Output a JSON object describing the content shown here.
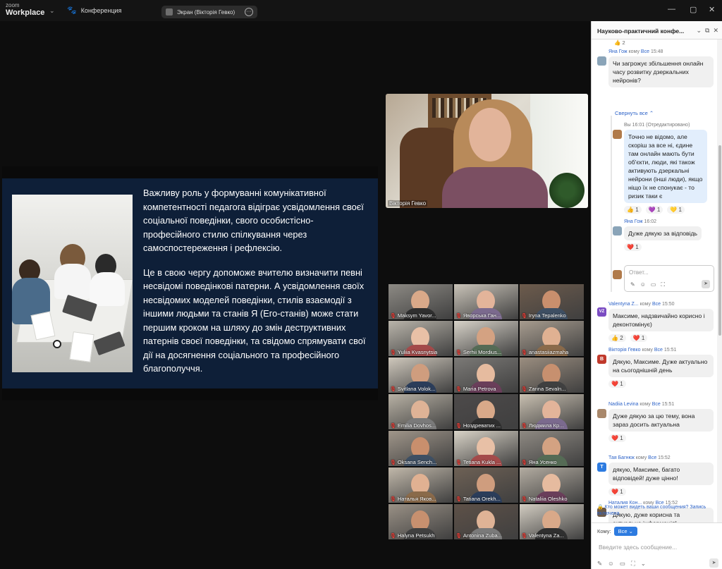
{
  "titlebar": {
    "logo_small": "zoom",
    "logo_big": "Workplace",
    "conference_label": "Конференция",
    "share_label": "Экран (Вікторія Гевко)",
    "min_icon": "minimize-icon",
    "max_icon": "maximize-icon",
    "close_icon": "close-icon"
  },
  "slide": {
    "paragraph1": "Важливу роль у формуванні комунікативної компетентності педагога відіграє усвідомлення своєї соціальної поведінки, свого особистісно-професійного стилю спілкування через самоспостереження і рефлексію.",
    "paragraph2": "Це в свою чергу допоможе вчителю визначити певні несвідомі поведінкові патерни. А усвідомлення своїх несвідомих моделей поведінки, стилів взаємодії з іншими людьми та станів Я (Его-станів) може стати першим кроком на шляху до змін деструктивних патернів своєї поведінки, та свідомо спрямувати свої дії на досягнення соціального та професійного благополуччя."
  },
  "speaker": {
    "name": "Вікторія Гевко"
  },
  "gallery": [
    {
      "name": "Maksym Yavor..."
    },
    {
      "name": "Яворська Ган..."
    },
    {
      "name": "Iryna Tepalenko"
    },
    {
      "name": "Yuliia Kvasnytsia"
    },
    {
      "name": "Serhii Mordius..."
    },
    {
      "name": "anastasiiazmaha"
    },
    {
      "name": "Svitlana Volok..."
    },
    {
      "name": "Maria Petrova"
    },
    {
      "name": "Zarina Sevaln..."
    },
    {
      "name": "Emilia Dovhos..."
    },
    {
      "name": "Ноздреватих ..."
    },
    {
      "name": "Людмила Кр..."
    },
    {
      "name": "Oksana Sench..."
    },
    {
      "name": "Tetiana Kukla ..."
    },
    {
      "name": "Яна Усенко"
    },
    {
      "name": "Наталья Яков..."
    },
    {
      "name": "Tatiana Orekh..."
    },
    {
      "name": "Nataliia Oleshko"
    },
    {
      "name": "Halyna Petsukh"
    },
    {
      "name": "Antonina Zuba..."
    },
    {
      "name": "Valentyna Za..."
    }
  ],
  "chat": {
    "title": "Науково-практичний конфе...",
    "top_count": "2",
    "m1": {
      "sender": "Яна Гож",
      "to_word": "кому",
      "to": "Все",
      "time": "15:48",
      "text": "Чи загрожує збільшення онлайн часу розвитку дзеркальних нейронів?"
    },
    "collapse": "Свернуть все",
    "m2": {
      "sender": "Вы",
      "time": "16:01",
      "edited": "(Отредактировано)",
      "text": "Точно не відомо, але скоріш за все ні, єдине там онлайн мають бути об'єкти, люди, які також активують дзеркальні нейрони (інші люди), якщо ніщо їх не спонукає - то ризик таки є",
      "r1": "1",
      "r2": "1",
      "r3": "1"
    },
    "m3": {
      "sender": "Яна Гож",
      "time": "16:02",
      "text": "Дуже дякую за відповідь",
      "r1": "1"
    },
    "reply_placeholder": "Ответ...",
    "m4": {
      "avatar": "VZ",
      "sender": "Valentyna Z...",
      "to_word": "кому",
      "to": "Все",
      "time": "15:50",
      "text": "Максиме, надзвичайно корисно і деконтомінує)",
      "r1": "2",
      "r2": "1"
    },
    "m5": {
      "avatar": "В",
      "sender": "Вікторія Гевко",
      "to_word": "кому",
      "to": "Все",
      "time": "15:51",
      "text": "Дякую, Максиме. Дуже актуально на сьогоднішній день",
      "r1": "1"
    },
    "m6": {
      "sender": "Nadiia Levina",
      "to_word": "кому",
      "to": "Все",
      "time": "15:51",
      "text": "Дуже дякую за цю тему, вона зараз досить актуальна",
      "r1": "1"
    },
    "m7": {
      "avatar": "Т",
      "sender": "Тая Багнюк",
      "to_word": "кому",
      "to": "Все",
      "time": "15:52",
      "text": "дякую, Максиме, багато відповідей! дуже цінно!",
      "r1": "1"
    },
    "m8": {
      "sender": "Наталия Кон...",
      "to_word": "кому",
      "to": "Все",
      "time": "15:52",
      "text": "Дякую, дуже корисна та актуальна інформація!"
    },
    "notice": "Кто может видеть ваши сообщения? Запись включена",
    "to_label": "Кому:",
    "to_value": "Все",
    "input_placeholder": "Введите здесь сообщение..."
  }
}
